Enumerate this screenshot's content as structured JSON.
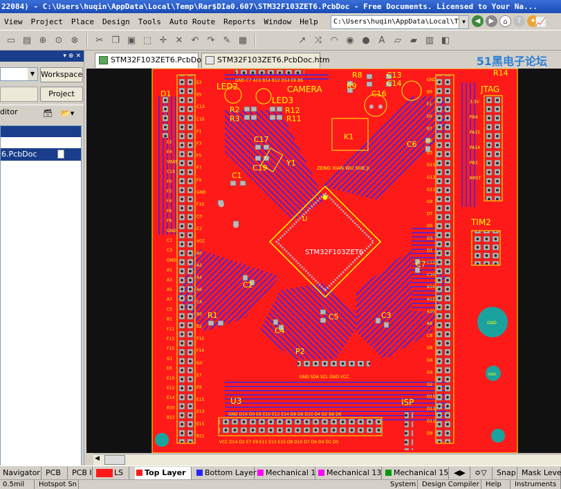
{
  "window": {
    "title": "22084) - C:\\Users\\huqin\\AppData\\Local\\Temp\\Rar$DIa0.607\\STM32F103ZET6.PcbDoc - Free Documents. Licensed to Your Na..."
  },
  "menu": {
    "items": [
      "View",
      "Project",
      "Place",
      "Design",
      "Tools",
      "Auto Route",
      "Reports",
      "Window",
      "Help"
    ]
  },
  "pathbar": {
    "value": "C:\\Users\\huqin\\AppData\\Local\\Te"
  },
  "left_panel": {
    "workspace_label": "Workspace",
    "project_label": "Project",
    "editor_label": "ditor",
    "tree_item": "6.PcbDoc"
  },
  "doc_tabs": [
    {
      "label": "STM32F103ZET6.PcbDoc",
      "active": true
    },
    {
      "label": "STM32F103ZET6.PcbDoc.htm",
      "active": false
    }
  ],
  "brand": "51黑电子论坛",
  "board": {
    "colors": {
      "top": "#ff1a1a",
      "bottom": "#2626ff",
      "pad": "#b8b8b8",
      "silk": "#ffff00",
      "bg": "#111111",
      "mech": "#1aa39e"
    },
    "labels": {
      "led2": "LED2",
      "led3": "LED3",
      "camera": "CAMERA",
      "r8": "R8",
      "r9": "R9",
      "c13": "C13",
      "c14": "C14",
      "c16": "C16",
      "r14": "R14",
      "jtag": "JTAG",
      "d1": "D1",
      "r2": "R2",
      "r3": "R3",
      "r12": "R12",
      "r11": "R11",
      "k1": "K1",
      "c6": "C6",
      "c17": "C17",
      "c19": "C19",
      "y1": "Y1",
      "c1": "C1",
      "author": "ZENG XIAN WU SHE JI",
      "chip": "STM32F103ZET6",
      "u_label": "U",
      "c7": "C7",
      "c2": "C2",
      "r1": "R1",
      "c4": "C4",
      "c5": "C5",
      "c3": "C3",
      "tim2": "TIM2",
      "p2": "P2",
      "u3": "U3",
      "isp": "ISP",
      "gnd": "GND",
      "header_bottom": "GND   SDA SCL GND VCC",
      "bottom_row": "VCC D14 D2 E7 E9 E11 E13 E15 D8 D10 D7 D6 D4 D1 D0",
      "top_row": "GND C7 A10 B14 B12 D14 E6 B6",
      "bottom_top_row": "GND D16 D0 E8 E10 E12 E14 D8 D8 D10 D4 D2 B8 D6"
    },
    "left_header_labels": [
      "E3",
      "E5",
      "C13",
      "C15",
      "F1",
      "F3",
      "F5",
      "F7",
      "F9",
      "GND",
      "F10",
      "C0",
      "C2",
      "VCC",
      "A0",
      "A2",
      "A4",
      "A6",
      "C4",
      "B0",
      "B2",
      "F12",
      "F14",
      "G0",
      "E7",
      "E9",
      "E11",
      "E13",
      "E15",
      "B11"
    ],
    "left_header_labels2": [
      "E2",
      "E4",
      "VBAT",
      "C14",
      "F0",
      "F2",
      "F4",
      "F6",
      "F8",
      "GND",
      "C1",
      "C3",
      "GND",
      "A1",
      "A3",
      "A5",
      "A7",
      "C5",
      "B1",
      "F11",
      "F13",
      "F15",
      "G1",
      "E8",
      "E10",
      "E12",
      "E14",
      "B10",
      "B12"
    ],
    "right_header_labels": [
      "GND",
      "B9",
      "E1",
      "E0",
      "B7",
      "B5",
      "B3",
      "G15",
      "G13",
      "G11",
      "G9",
      "D7",
      "D5",
      "D3",
      "D1",
      "C12",
      "C10",
      "A14",
      "A12",
      "A10",
      "A8",
      "C8",
      "G8",
      "G6",
      "G4",
      "G2",
      "D15",
      "D13",
      "D11",
      "D9"
    ],
    "jtag_labels": [
      "3.3V",
      "PB4",
      "PA15",
      "PA14",
      "PB3",
      "NRST"
    ]
  },
  "layers": {
    "ls": "LS",
    "tabs": [
      {
        "label": "Top Layer",
        "color": "#ff1a1a",
        "active": true
      },
      {
        "label": "Bottom Layer",
        "color": "#2626ff",
        "active": false
      },
      {
        "label": "Mechanical 1",
        "color": "#ff00ff",
        "active": false
      },
      {
        "label": "Mechanical 13",
        "color": "#ff00ff",
        "active": false
      },
      {
        "label": "Mechanical 15",
        "color": "#009900",
        "active": false
      }
    ],
    "snap": "Snap",
    "mask": "Mask Level"
  },
  "panel_tabs": [
    "Navigator",
    "PCB",
    "PCB I"
  ],
  "status": {
    "coord": "0.5mil",
    "hotspot": "Hotspot Sn",
    "system": "System",
    "compiler": "Design Compiler",
    "help": "Help",
    "instruments": "Instruments"
  }
}
